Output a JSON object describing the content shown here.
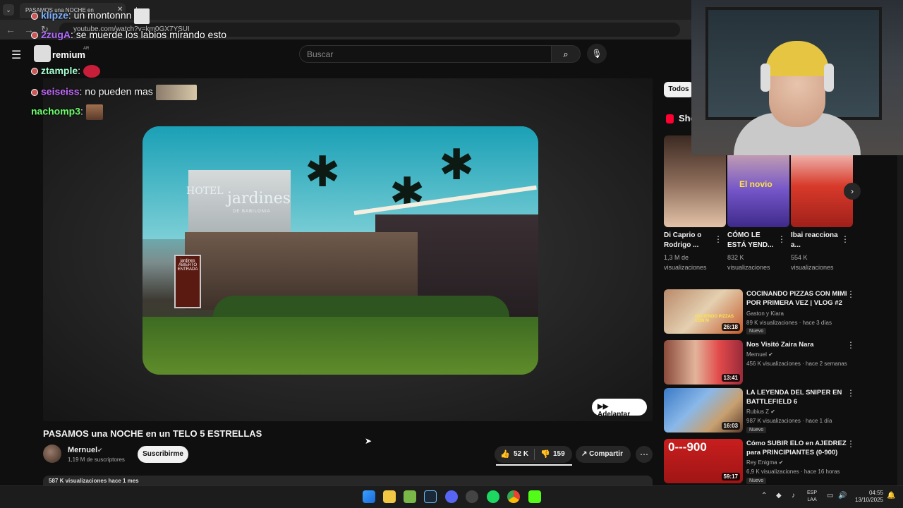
{
  "browser": {
    "tab_title": "PASAMOS una NOCHE en",
    "url": "youtube.com/watch?v=km0GX7YSUI"
  },
  "youtube": {
    "logo_text": "remium",
    "logo_country": "AR",
    "search_placeholder": "Buscar"
  },
  "chat": [
    {
      "user": "klipze",
      "message": ": un montonnn",
      "color": "#7fb2ff"
    },
    {
      "user": "2zugA",
      "message": ": se muerde los labios mirando esto",
      "color": "#b06bff"
    },
    {
      "user": "ztample",
      "message": ":",
      "color": "#a6ffcf"
    },
    {
      "user": "seiseiss",
      "message": ": no pueden mas",
      "color": "#c56bff"
    },
    {
      "user": "nachomp3",
      "message": ":",
      "color": "#6bff6b"
    }
  ],
  "thumbnail": {
    "sign_main": "jardines",
    "sign_sub": "DE BABILONIA",
    "sign_hotel": "HOTEL",
    "entry_sign": "jardines ABIERTO ENTRADA"
  },
  "player": {
    "skip_label": "Adelantar"
  },
  "video": {
    "title": "PASAMOS una NOCHE en un TELO 5 ESTRELLAS",
    "channel": "Mernuel",
    "subscribers": "1,19 M de suscriptores",
    "subscribe_label": "Suscribirme",
    "likes": "52 K",
    "dislikes": "159",
    "share_label": "Compartir",
    "description_preview": "587 K visualizaciones  hace 1 mes"
  },
  "sidebar": {
    "chip_all": "Todos",
    "shorts_label": "Sho",
    "shorts": [
      {
        "title": "Di Caprio o Rodrigo ...",
        "views": "1,3 M de visualizaciones",
        "overlay": ""
      },
      {
        "title": "CÓMO LE ESTÁ YEND...",
        "views": "832 K visualizaciones",
        "overlay": "El novio"
      },
      {
        "title": "Ibai reacciona a...",
        "views": "554 K visualizaciones",
        "overlay": ""
      }
    ],
    "recommendations": [
      {
        "title": "COCINANDO PIZZAS CON MIMI POR PRIMERA VEZ | VLOG #2",
        "channel": "Gaston y Kiara",
        "meta": "89 K visualizaciones · hace 3 días",
        "badge": "Nuevo",
        "duration": "26:18",
        "thumb_text": "HACIENDO PIZZAS CON M",
        "verified": false
      },
      {
        "title": "Nos Visitó Zaira Nara",
        "channel": "Mernuel",
        "meta": "456 K visualizaciones · hace 2 semanas",
        "badge": "",
        "duration": "13:41",
        "thumb_text": "",
        "verified": true
      },
      {
        "title": "LA LEYENDA DEL SNIPER EN BATTLEFIELD 6",
        "channel": "Rubius Z",
        "meta": "987 K visualizaciones · hace 1 día",
        "badge": "Nuevo",
        "duration": "16:03",
        "thumb_text": "",
        "verified": true
      },
      {
        "title": "Cómo SUBIR ELO en AJEDREZ para PRINCIPIANTES (0-900)",
        "channel": "Rey Enigma",
        "meta": "6,9 K visualizaciones · hace 16 horas",
        "badge": "Nuevo",
        "duration": "59:17",
        "thumb_text": "0---900",
        "verified": true
      }
    ]
  },
  "taskbar": {
    "lang_top": "ESP",
    "lang_bottom": "LAA",
    "time": "04:55",
    "date": "13/10/2025"
  }
}
